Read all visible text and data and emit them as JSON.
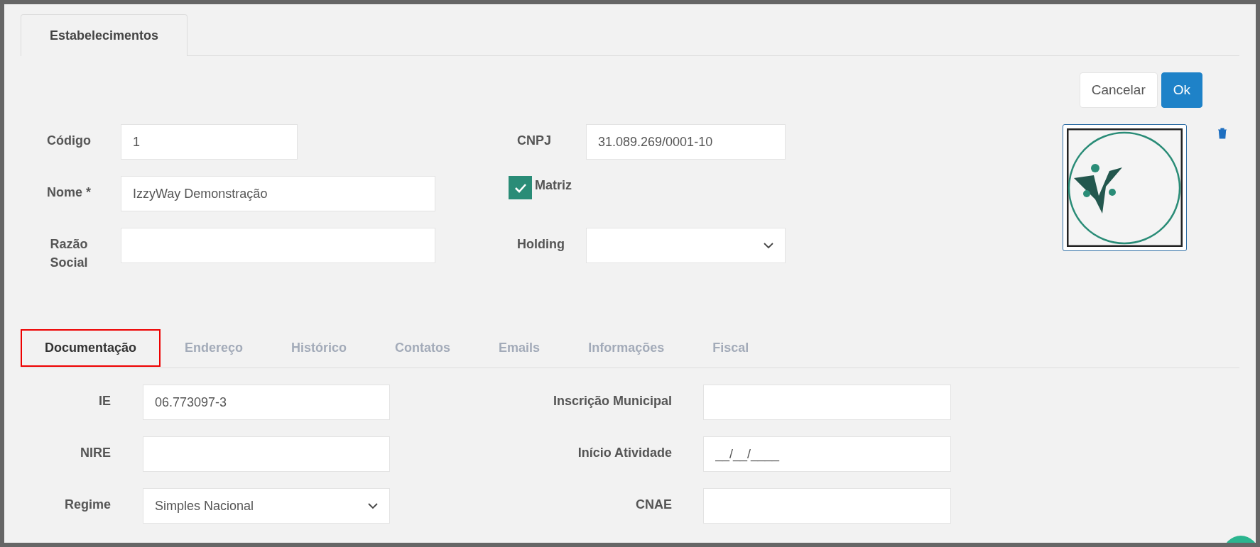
{
  "header_tab": {
    "label": "Estabelecimentos"
  },
  "actions": [
    {
      "label": "Cancelar",
      "kind": "secondary"
    },
    {
      "label": "Ok",
      "kind": "primary"
    }
  ],
  "identity": {
    "left": [
      {
        "label": "Código",
        "value": "1"
      },
      {
        "label": "Nome *",
        "value": "IzzyWay Demonstração"
      },
      {
        "label": "Razão Social"
      }
    ],
    "right": [
      {
        "kind": "input",
        "label": "CNPJ",
        "value": "31.089.269/0001-10"
      },
      {
        "kind": "checkbox",
        "label": "Matriz",
        "checked": true
      },
      {
        "kind": "select",
        "label": "Holding"
      }
    ]
  },
  "section_tabs": [
    {
      "label": "Documentação",
      "selected": true
    },
    {
      "label": "Endereço",
      "selected": false
    },
    {
      "label": "Histórico",
      "selected": false
    },
    {
      "label": "Contatos",
      "selected": false
    },
    {
      "label": "Emails",
      "selected": false
    },
    {
      "label": "Informações",
      "selected": false
    },
    {
      "label": "Fiscal",
      "selected": false
    }
  ],
  "documentation_fields": [
    {
      "kind": "input",
      "label": "IE",
      "value": "06.773097-3"
    },
    {
      "kind": "input",
      "label": "Inscrição Municipal"
    },
    {
      "kind": "input",
      "label": "NIRE"
    },
    {
      "kind": "input",
      "label": "Início Atividade",
      "placeholder": "__/__/____"
    },
    {
      "kind": "select",
      "label": "Regime",
      "value": "Simples Nacional"
    },
    {
      "kind": "input",
      "label": "CNAE"
    }
  ]
}
